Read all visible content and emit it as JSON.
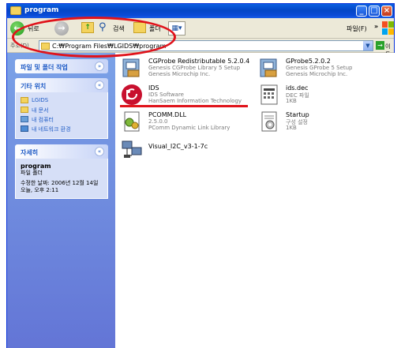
{
  "window": {
    "title": "program",
    "controls": {
      "minimize": "_",
      "maximize": "□",
      "close": "×"
    }
  },
  "toolbar": {
    "back_label": "뒤로",
    "search_label": "검색",
    "folders_label": "폴더",
    "file_menu": "파일(F)",
    "chevron": "»"
  },
  "address": {
    "label": "주소(D)",
    "path": "C:₩Program Files₩LGIDS₩program",
    "go_label": "이동"
  },
  "taskpane": {
    "file_tasks_title": "파일 및 폴더 작업",
    "other_places_title": "기타 위치",
    "other_places": [
      {
        "label": "LGIDS",
        "icon": "folder-icon"
      },
      {
        "label": "내 문서",
        "icon": "my-documents-icon"
      },
      {
        "label": "내 컴퓨터",
        "icon": "my-computer-icon"
      },
      {
        "label": "내 네트워크 환경",
        "icon": "network-icon"
      }
    ],
    "details_title": "자세히",
    "details": {
      "name": "program",
      "type": "파일 폴더",
      "modified": "수정한 날짜: 2006년 12월 14일 오늘, 오후 2:11"
    }
  },
  "files": [
    {
      "name": "CGProbe Redistributable 5.2.0.4",
      "line1": "Genesis CGProbe Library 5 Setup",
      "line2": "Genesis Microchip Inc.",
      "icon": "installer-icon"
    },
    {
      "name": "GProbe5.2.0.2",
      "line1": "Genesis GProbe 5 Setup",
      "line2": "Genesis Microchip Inc.",
      "icon": "installer-icon"
    },
    {
      "name": "IDS",
      "line1": "IDS Software",
      "line2": "HanSaem Information Technology",
      "icon": "lg-logo-icon"
    },
    {
      "name": "ids.dec",
      "line1": "DEC 파일",
      "line2": "1KB",
      "icon": "dec-file-icon"
    },
    {
      "name": "PCOMM.DLL",
      "line1": "2.5.0.0",
      "line2": "PComm Dynamic Link Library",
      "icon": "dll-icon"
    },
    {
      "name": "Startup",
      "line1": "구성 설정",
      "line2": "1KB",
      "icon": "settings-file-icon"
    },
    {
      "name": "Visual_I2C_v3-1-7c",
      "line1": "",
      "line2": "",
      "icon": "network-app-icon"
    }
  ],
  "colors": {
    "titlebar": "#0346c6",
    "taskpane": "#6d8ee0",
    "annotation": "#e0131b"
  }
}
